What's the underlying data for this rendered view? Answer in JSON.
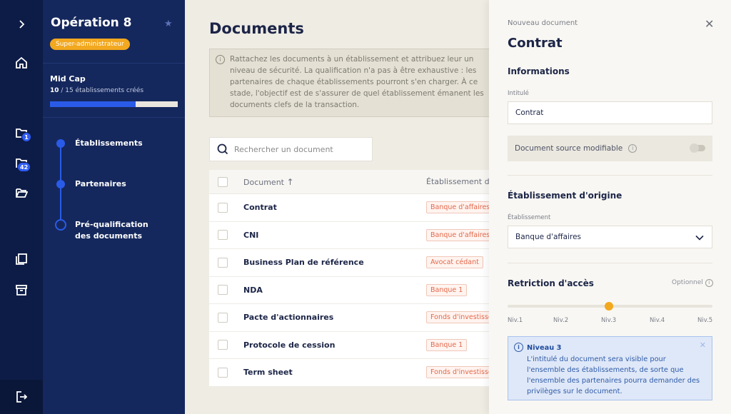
{
  "rail": {
    "badges": {
      "folder1": "1",
      "folder2": "42"
    }
  },
  "nav": {
    "title": "Opération 8",
    "role_badge": "Super-administrateur",
    "plan": "Mid Cap",
    "count_created": "10",
    "count_rest": " / 15 établissements créés",
    "progress": 0.67,
    "steps": [
      {
        "label": "Établissements",
        "state": "done"
      },
      {
        "label": "Partenaires",
        "state": "done"
      },
      {
        "label": "Pré-qualification des documents",
        "state": "current"
      }
    ]
  },
  "main": {
    "title": "Documents",
    "info": "Rattachez les documents à un établissement et attribuez leur un niveau de sécurité. La qualification n'a pas à être exhaustive : les partenaires de chaque établissements pourront s'en charger. À ce stade, l'objectif est de s'assurer de quel établissement émanent les documents clefs de la transaction.",
    "search_placeholder": "Rechercher un document",
    "table": {
      "col_document": "Document",
      "col_etab": "Établissement d'",
      "rows": [
        {
          "doc": "Contrat",
          "etab": "Banque d'affaires"
        },
        {
          "doc": "CNI",
          "etab": "Banque d'affaires"
        },
        {
          "doc": "Business Plan de référence",
          "etab": "Avocat cédant"
        },
        {
          "doc": "NDA",
          "etab": "Banque 1"
        },
        {
          "doc": "Pacte d'actionnaires",
          "etab": "Fonds d'investisse"
        },
        {
          "doc": "Protocole de cession",
          "etab": "Banque 1"
        },
        {
          "doc": "Term sheet",
          "etab": "Fonds d'investisse"
        }
      ]
    }
  },
  "panel": {
    "subtitle": "Nouveau document",
    "title": "Contrat",
    "section_info": "Informations",
    "label_intitule": "Intitulé",
    "intitule_value": "Contrat",
    "toggle_label": "Document source modifiable",
    "section_origin": "Établissement d'origine",
    "label_etab": "Établissement",
    "etab_value": "Banque d'affaires",
    "section_access": "Retriction d'accès",
    "optional": "Optionnel",
    "levels": [
      "Niv.1",
      "Niv.2",
      "Niv.3",
      "Niv.4",
      "Niv.5"
    ],
    "selected_level": 3,
    "alert_title": "Niveau 3",
    "alert_text": "L'intitulé du document sera visible pour l'ensemble des établissements, de sorte que l'ensemble des partenaires pourra demander des privilèges sur le document."
  },
  "colors": {
    "sidebar": "#0d1c47",
    "nav": "#15285d",
    "accent": "#2a5be8",
    "badge_orange": "#f2a81f",
    "tag_red": "#e3684a"
  }
}
